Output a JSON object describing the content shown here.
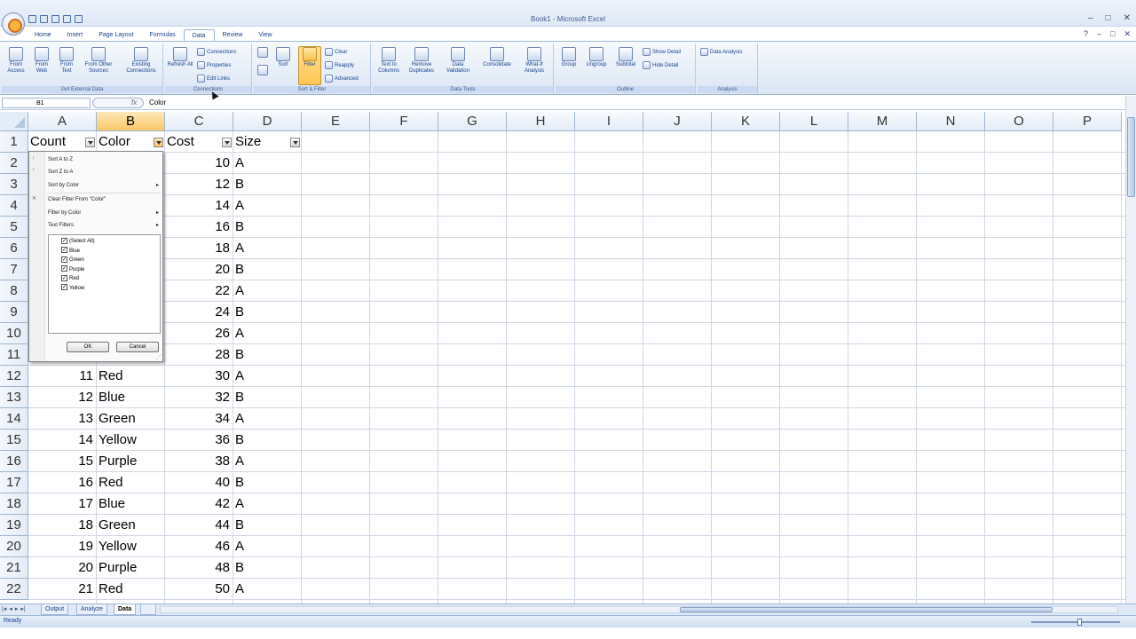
{
  "window": {
    "title": "Book1 - Microsoft Excel",
    "controls": [
      "–",
      "□",
      "✕"
    ]
  },
  "ribbon": {
    "tabs": [
      "Home",
      "Insert",
      "Page Layout",
      "Formulas",
      "Data",
      "Review",
      "View"
    ],
    "active_tab": "Data",
    "right_controls": [
      "?",
      "–",
      "□",
      "✕"
    ],
    "groups": {
      "get_external": {
        "label": "Get External Data",
        "buttons": [
          "From Access",
          "From Web",
          "From Text",
          "From Other Sources",
          "Existing Connections"
        ]
      },
      "connections": {
        "label": "Connections",
        "refresh": "Refresh All",
        "items": [
          "Connections",
          "Properties",
          "Edit Links"
        ]
      },
      "sort_filter": {
        "label": "Sort & Filter",
        "sort": "Sort",
        "filter": "Filter",
        "items": [
          "Clear",
          "Reapply",
          "Advanced"
        ]
      },
      "data_tools": {
        "label": "Data Tools",
        "buttons": [
          "Text to Columns",
          "Remove Duplicates",
          "Data Validation",
          "Consolidate",
          "What-If Analysis"
        ]
      },
      "outline": {
        "label": "Outline",
        "buttons": [
          "Group",
          "Ungroup",
          "Subtotal"
        ],
        "items": [
          "Show Detail",
          "Hide Detail"
        ]
      },
      "analysis": {
        "label": "Analysis",
        "button": "Data Analysis"
      }
    }
  },
  "formula_bar": {
    "name_box": "B1",
    "fx": "fx",
    "formula": "Color"
  },
  "columns": [
    "A",
    "B",
    "C",
    "D",
    "E",
    "F",
    "G",
    "H",
    "I",
    "J",
    "K",
    "L",
    "M",
    "N",
    "O",
    "P"
  ],
  "selected_column": "B",
  "row_numbers": [
    1,
    2,
    3,
    4,
    5,
    6,
    7,
    8,
    9,
    10,
    11,
    12,
    13,
    14,
    15,
    16,
    17,
    18,
    19,
    20,
    21,
    22
  ],
  "headers": [
    "Count",
    "Color",
    "Cost",
    "Size"
  ],
  "rows": [
    {
      "c": "10",
      "d": "A"
    },
    {
      "c": "12",
      "d": "B"
    },
    {
      "c": "14",
      "d": "A"
    },
    {
      "c": "16",
      "d": "B"
    },
    {
      "c": "18",
      "d": "A"
    },
    {
      "c": "20",
      "d": "B"
    },
    {
      "c": "22",
      "d": "A"
    },
    {
      "c": "24",
      "d": "B"
    },
    {
      "c": "26",
      "d": "A"
    },
    {
      "c": "28",
      "d": "B"
    },
    {
      "a": "11",
      "b": "Red",
      "c": "30",
      "d": "A"
    },
    {
      "a": "12",
      "b": "Blue",
      "c": "32",
      "d": "B"
    },
    {
      "a": "13",
      "b": "Green",
      "c": "34",
      "d": "A"
    },
    {
      "a": "14",
      "b": "Yellow",
      "c": "36",
      "d": "B"
    },
    {
      "a": "15",
      "b": "Purple",
      "c": "38",
      "d": "A"
    },
    {
      "a": "16",
      "b": "Red",
      "c": "40",
      "d": "B"
    },
    {
      "a": "17",
      "b": "Blue",
      "c": "42",
      "d": "A"
    },
    {
      "a": "18",
      "b": "Green",
      "c": "44",
      "d": "B"
    },
    {
      "a": "19",
      "b": "Yellow",
      "c": "46",
      "d": "A"
    },
    {
      "a": "20",
      "b": "Purple",
      "c": "48",
      "d": "B"
    },
    {
      "a": "21",
      "b": "Red",
      "c": "50",
      "d": "A"
    }
  ],
  "filter_menu": {
    "items": [
      "Sort A to Z",
      "Sort Z to A",
      "Sort by Color",
      "Clear Filter From \"Color\"",
      "Filter by Color",
      "Text Filters"
    ],
    "checklist": [
      "(Select All)",
      "Blue",
      "Green",
      "Purple",
      "Red",
      "Yellow"
    ],
    "ok": "OK",
    "cancel": "Cancel"
  },
  "sheets": [
    "Output",
    "Analyze",
    "Data"
  ],
  "active_sheet": "Data",
  "status": {
    "text": "Ready"
  },
  "colors": {
    "accent": "#15428b",
    "selected_header": "#f9c76a",
    "grid": "#d0d7e5"
  }
}
